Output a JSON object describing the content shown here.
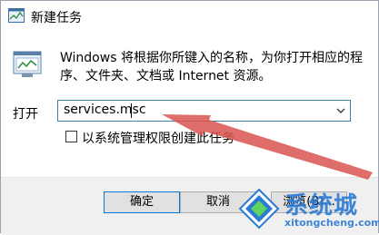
{
  "window": {
    "title": "新建任务"
  },
  "body": {
    "description": "Windows 将根据你所键入的名称，为你打开相应的程序、文件夹、文档或 Internet 资源。",
    "open_label": "打开",
    "command_value": "services.msc",
    "admin_checkbox_label": "以系统管理权限创建此任务",
    "admin_checked": false
  },
  "buttons": {
    "ok": "确定",
    "cancel": "取消",
    "browse": "浏览(B)..."
  },
  "watermark": {
    "brand": "系统城",
    "url": "xitongcheng.com"
  },
  "colors": {
    "arrow": "#d9534f",
    "accent": "#0078d7",
    "watermark": "#2b7ad4"
  },
  "icons": [
    "task-manager-icon",
    "program-window-icon",
    "dropdown-chevron-icon",
    "red-arrow-annotation",
    "watermark-logo-icon"
  ]
}
